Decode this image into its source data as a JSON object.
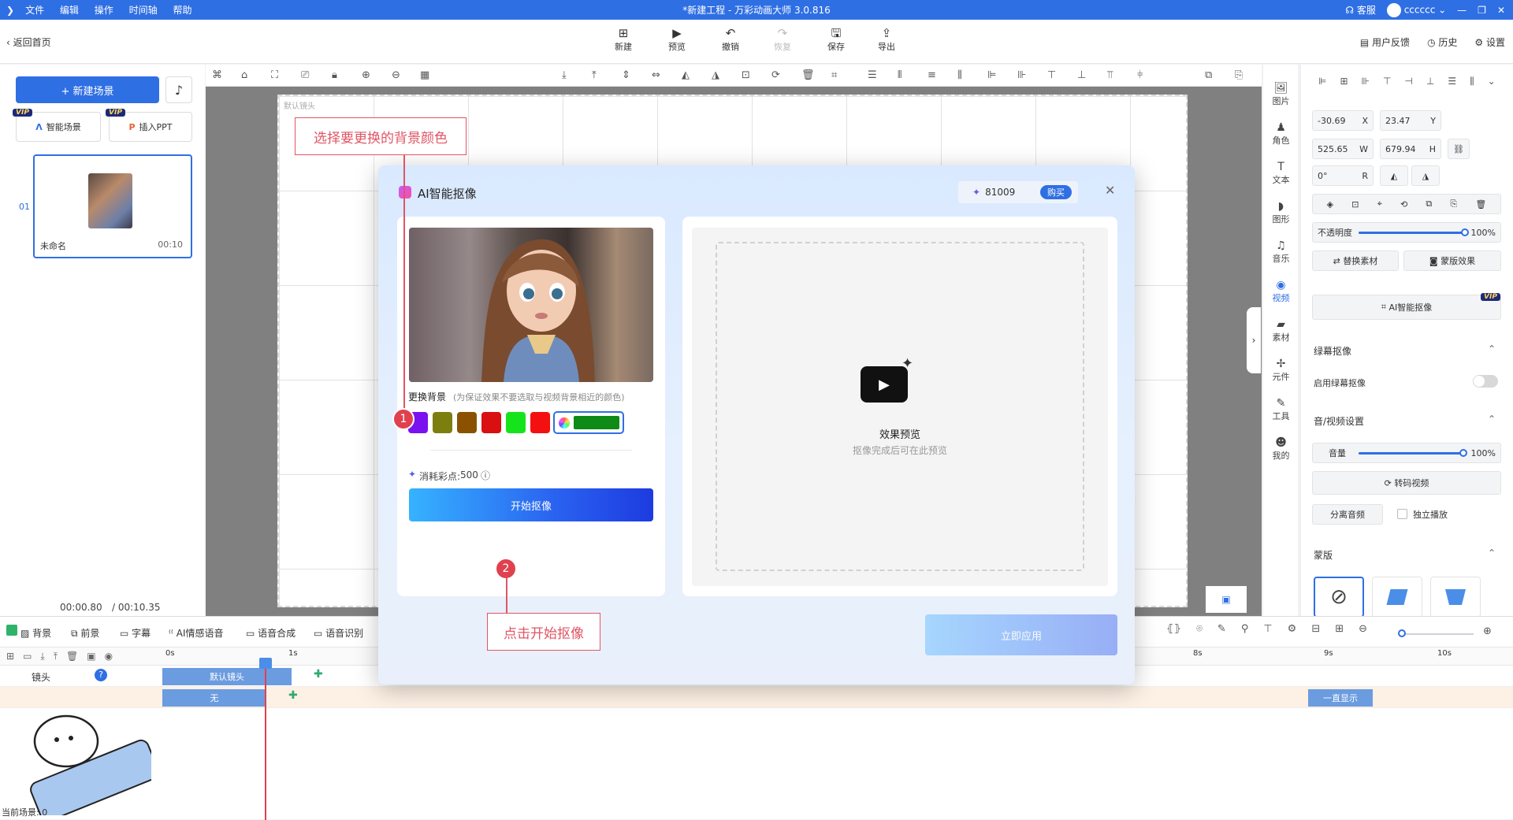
{
  "titlebar": {
    "menu": [
      "文件",
      "编辑",
      "操作",
      "时间轴",
      "帮助"
    ],
    "title": "*新建工程 - 万彩动画大师 3.0.816",
    "service": "客服",
    "user": "cccccc"
  },
  "toolbar": {
    "back": "返回首页",
    "buttons": [
      {
        "label": "新建",
        "icon": "plus-square-icon"
      },
      {
        "label": "预览",
        "icon": "play-icon"
      },
      {
        "label": "撤销",
        "icon": "undo-icon"
      },
      {
        "label": "恢复",
        "icon": "redo-icon"
      },
      {
        "label": "保存",
        "icon": "save-icon"
      },
      {
        "label": "导出",
        "icon": "export-icon"
      }
    ],
    "right": [
      "用户反馈",
      "历史",
      "设置"
    ]
  },
  "left": {
    "new_scene": "+ 新建场景",
    "smart_scene": "智能场景",
    "insert_ppt": "插入PPT",
    "vip": "VIP",
    "scene": {
      "index": "01",
      "name": "未命名",
      "duration": "00:10"
    },
    "time_current": "00:00.80",
    "time_total": "/ 00:10.35"
  },
  "stage": {
    "camera_label": "默认镜头"
  },
  "sidebar_icons": [
    {
      "label": "图片",
      "icon": "image-icon"
    },
    {
      "label": "角色",
      "icon": "person-icon"
    },
    {
      "label": "文本",
      "icon": "text-icon"
    },
    {
      "label": "图形",
      "icon": "shape-icon"
    },
    {
      "label": "音乐",
      "icon": "music-icon"
    },
    {
      "label": "视频",
      "icon": "video-icon"
    },
    {
      "label": "素材",
      "icon": "folder-icon"
    },
    {
      "label": "元件",
      "icon": "widget-icon"
    },
    {
      "label": "工具",
      "icon": "wrench-icon"
    },
    {
      "label": "我的",
      "icon": "user-icon"
    }
  ],
  "props": {
    "x": "-30.69",
    "x_label": "X",
    "y": "23.47",
    "y_label": "Y",
    "w": "525.65",
    "w_label": "W",
    "h": "679.94",
    "h_label": "H",
    "rotation": "0°",
    "r_label": "R",
    "opacity_label": "不透明度",
    "opacity": "100%",
    "opacity_fraction": 1.0,
    "replace": "替换素材",
    "mask_effect": "蒙版效果",
    "ai_matting": "AI智能抠像",
    "green_section": "绿幕抠像",
    "green_enable": "启用绿幕抠像",
    "av_section": "音/视频设置",
    "volume_label": "音量",
    "volume": "100%",
    "volume_fraction": 1.0,
    "transcode": "转码视频",
    "separate_audio": "分离音频",
    "independent_play": "独立播放",
    "mask_section": "蒙版"
  },
  "timeline": {
    "tabs": [
      "背景",
      "前景",
      "字幕",
      "AI情感语音",
      "语音合成",
      "语音识别"
    ],
    "ruler": [
      "0s",
      "1s",
      "8s",
      "9s",
      "10s"
    ],
    "tracks": [
      {
        "name": "镜头",
        "clip": "默认镜头"
      },
      {
        "name": "",
        "clip": "无",
        "clip2": "一直显示"
      }
    ],
    "current_scene": "当前场景: 0"
  },
  "dialog": {
    "title": "AI智能抠像",
    "points": "81009",
    "buy": "购买",
    "bg_label": "更换背景",
    "bg_hint": "(为保证效果不要选取与视频背景相近的颜色)",
    "swatches": [
      "#7a12f0",
      "#7d7e10",
      "#8a5200",
      "#d90f12",
      "#15e41c",
      "#f41010"
    ],
    "selected_color": "#0e8a16",
    "cost_label": "消耗彩点:",
    "cost_value": "500",
    "start": "开始抠像",
    "preview_title": "效果预览",
    "preview_hint": "抠像完成后可在此预览",
    "apply": "立即应用"
  },
  "annotations": {
    "callout1": "选择要更换的背景颜色",
    "callout2": "点击开始抠像",
    "marker1": "1",
    "marker2": "2"
  }
}
